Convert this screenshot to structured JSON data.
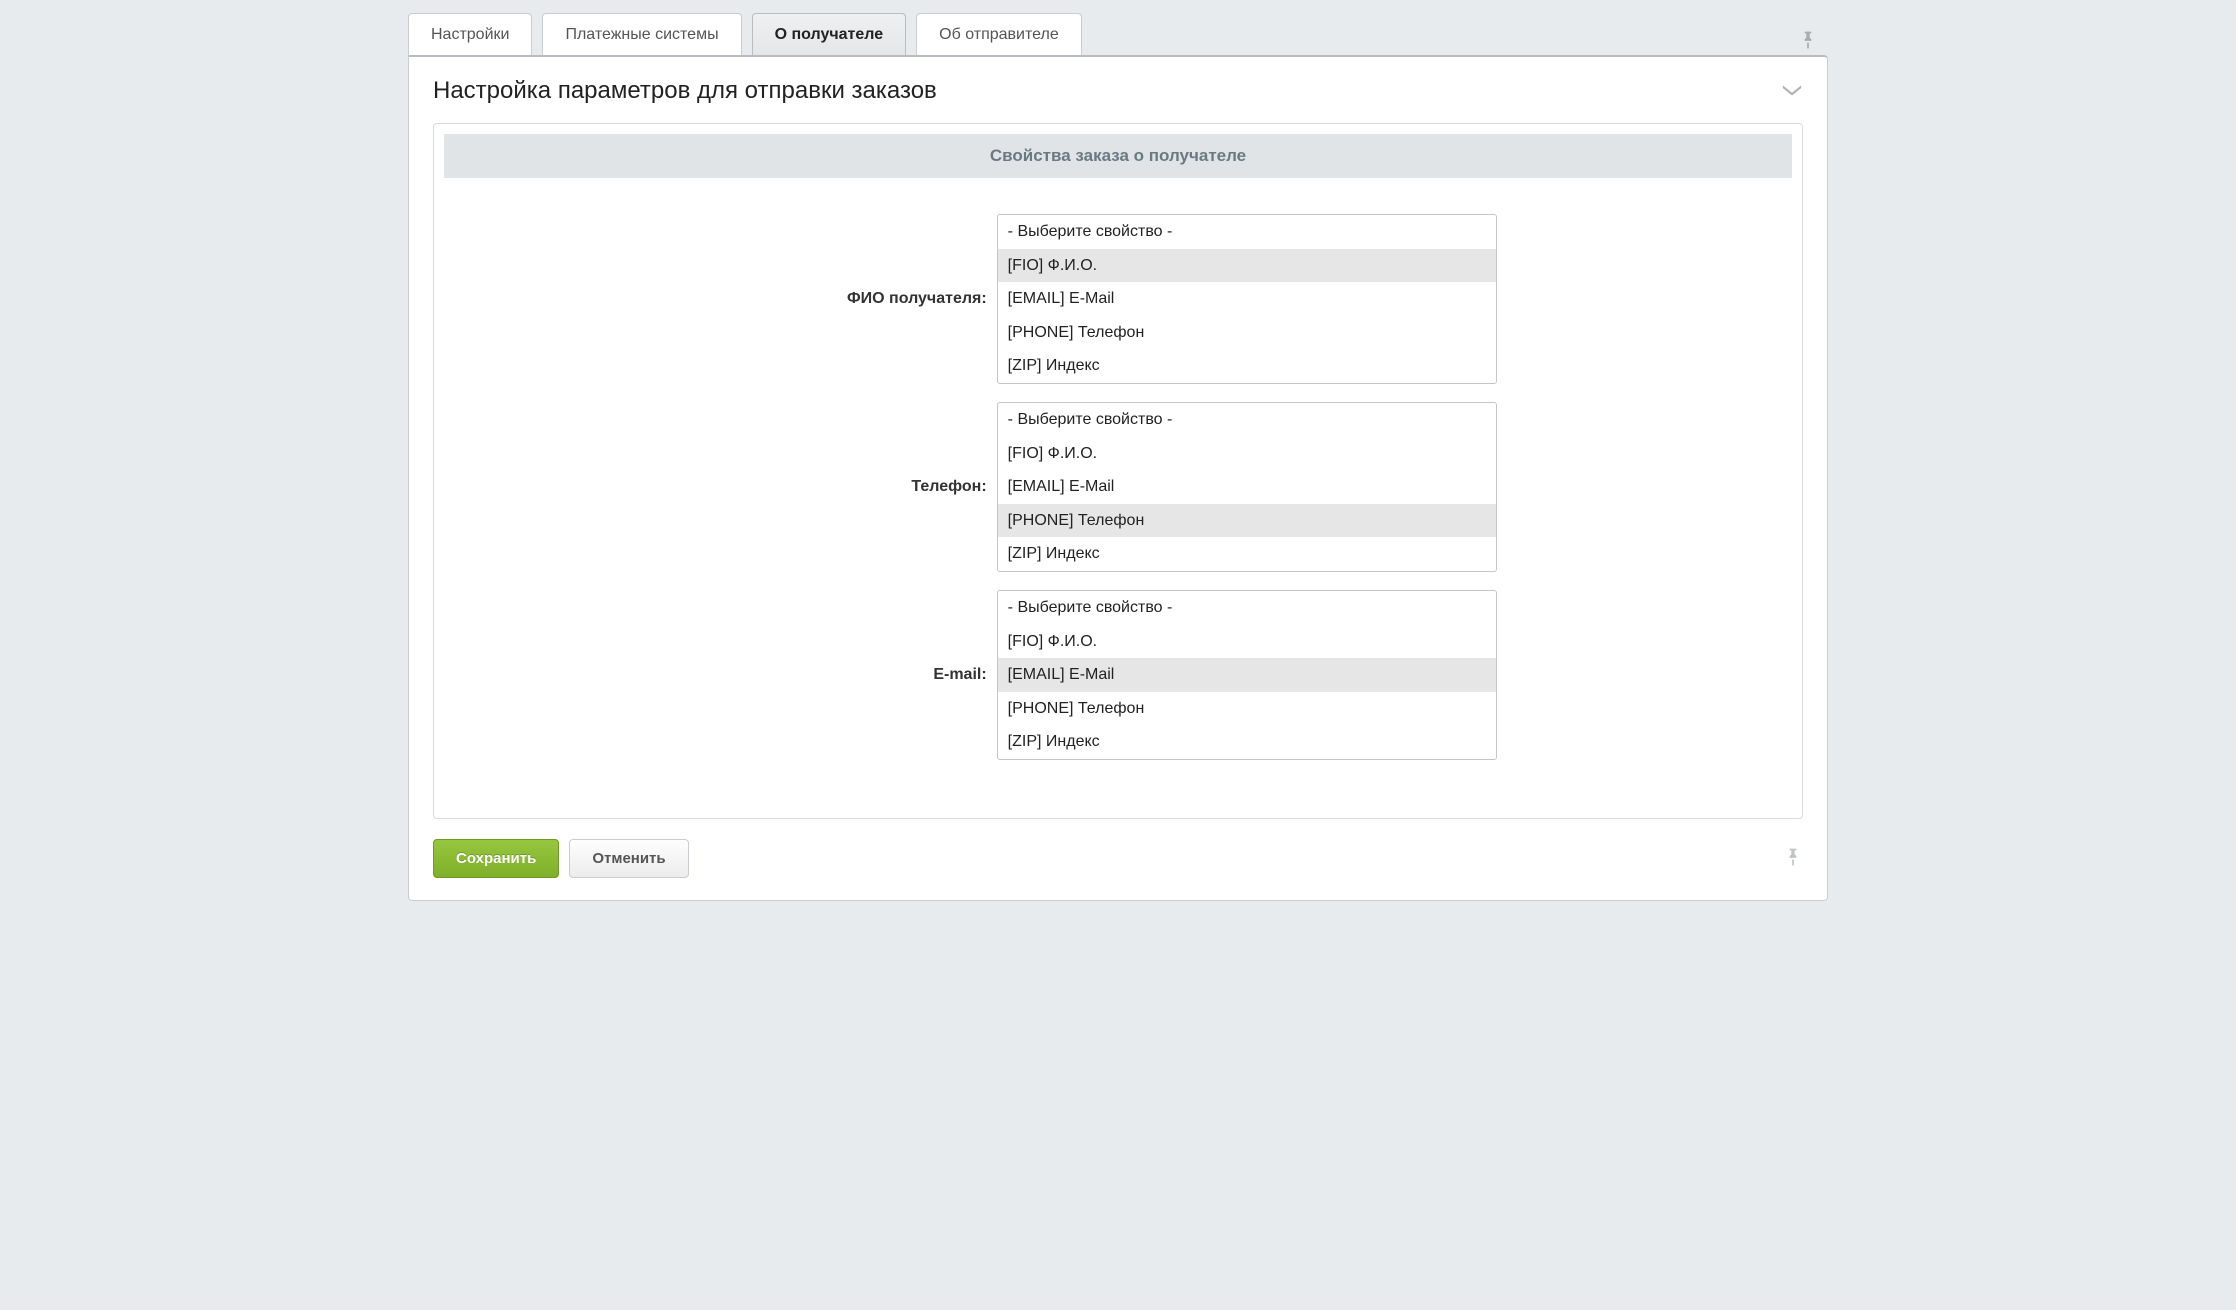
{
  "tabs": [
    {
      "label": "Настройки",
      "active": false
    },
    {
      "label": "Платежные системы",
      "active": false
    },
    {
      "label": "О получателе",
      "active": true
    },
    {
      "label": "Об отправителе",
      "active": false
    }
  ],
  "panel": {
    "title": "Настройка параметров для отправки заказов"
  },
  "section": {
    "title": "Свойства заказа о получателе"
  },
  "options": [
    "- Выберите свойство -",
    "[FIO] Ф.И.О.",
    "[EMAIL] E-Mail",
    "[PHONE] Телефон",
    "[ZIP] Индекс"
  ],
  "fields": [
    {
      "label": "ФИО получателя",
      "selected_index": 1
    },
    {
      "label": "Телефон",
      "selected_index": 3
    },
    {
      "label": "E-mail",
      "selected_index": 2
    }
  ],
  "buttons": {
    "save": "Сохранить",
    "cancel": "Отменить"
  }
}
